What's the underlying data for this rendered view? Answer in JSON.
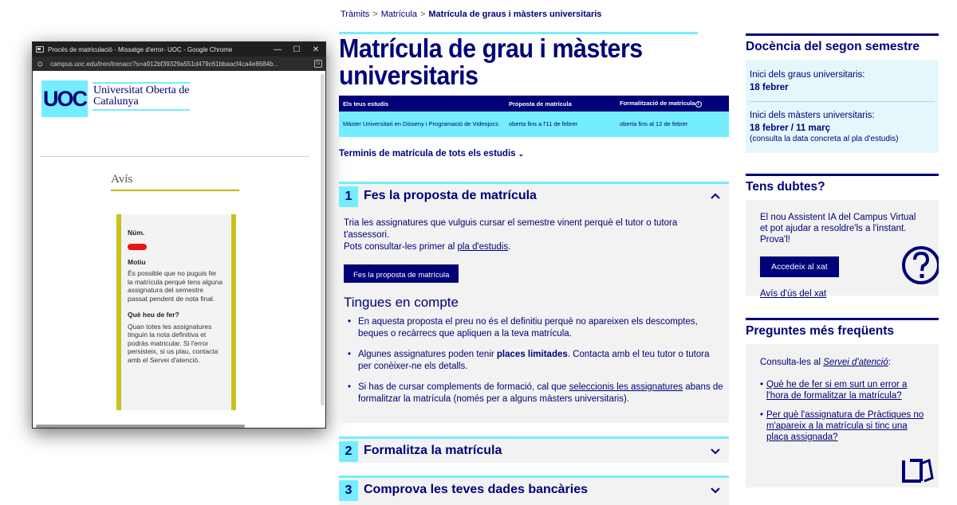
{
  "popup": {
    "window_title": "Procés de matriculació - Missatge d'error- UOC - Google Chrome",
    "url": "campus.uoc.edu/tren/trenacc?s=a912bf39329a551d479c61bbaacf4ca4e8684b...",
    "minimize": "—",
    "maximize": "☐",
    "close": "✕",
    "logo_text": "UOC",
    "university_name": "Universitat Oberta de Catalunya",
    "avis_title": "Avís",
    "num_label": "Núm.",
    "motiu_label": "Motiu",
    "motiu_text": "És possible que no puguis fer la matrícula perquè tens alguna assignatura del semestre passat pendent de nota final.",
    "que_fer_label": "Què heu de fer?",
    "que_fer_text": "Quan totes les assignatures tinguin la nota definitiva et podràs matricular. Si l'error persisteix, si us plau, contacta amb el Servei d'atenció."
  },
  "breadcrumb": {
    "items": [
      "Tràmits",
      "Matrícula"
    ],
    "separator": ">",
    "current": "Matrícula de graus i màsters universitaris"
  },
  "main": {
    "title": "Matrícula de grau i màsters universitaris",
    "table": {
      "headers": [
        "Els teus estudis",
        "Proposta de matrícula",
        "Formalització de matrícula"
      ],
      "rows": [
        [
          "Màster Universitari en Disseny i Programació de Videojocs",
          "oberta fins a l'11 de febrer",
          "oberta fins al 12 de febrer"
        ]
      ]
    },
    "terminis_link": "Terminis de matrícula de tots els estudis",
    "steps": [
      {
        "number": "1",
        "title": "Fes la proposta de matrícula",
        "intro_1": "Tria les assignatures que vulguis cursar el semestre vinent perquè el tutor o tutora t'assessori.",
        "intro_2": "Pots consultar-les primer al ",
        "intro_link": "pla d'estudis",
        "intro_end": ".",
        "button": "Fes la proposta de matrícula",
        "subtitle": "Tingues en compte",
        "bullet_1": "En aquesta proposta el preu no és el definitiu perquè no apareixen els descomptes, beques o recàrrecs que apliquen a la teva matrícula.",
        "bullet_2_a": "Algunes assignatures poden tenir ",
        "bullet_2_b": "places limitades",
        "bullet_2_c": ". Contacta amb el teu tutor o tutora per conèixer-ne els detalls.",
        "bullet_3_a": "Si has de cursar complements de formació, cal que ",
        "bullet_3_link": "seleccionis les assignatures",
        "bullet_3_b": " abans de formalitzar la matrícula (només per a alguns màsters universitaris)."
      },
      {
        "number": "2",
        "title": "Formalitza la matrícula"
      },
      {
        "number": "3",
        "title": "Comprova les teves dades bancàries"
      }
    ]
  },
  "sidebar": {
    "docencia": {
      "heading": "Docència del segon semestre",
      "graus_label": "Inici dels graus universitaris:",
      "graus_date": "18 febrer",
      "masters_label": "Inici dels màsters universitaris:",
      "masters_date": "18 febrer / 11 març",
      "masters_note": "(consulta la data concreta al pla d'estudis)"
    },
    "dubtes": {
      "heading": "Tens dubtes?",
      "text": "El nou Assistent IA del Campus Virtual et pot ajudar a resoldre'ls a l'instant. Prova'l!",
      "button": "Accedeix al xat",
      "link": "Avís d'ús del xat"
    },
    "faq": {
      "heading": "Preguntes més freqüents",
      "intro": "Consulta-les al ",
      "intro_link": "Servei d'atenció",
      "intro_end": ":",
      "items": [
        "Què he de fer si em surt un error a l'hora de formalitzar la matrícula?",
        "Per què l'assignatura de Pràctiques no m'apareix a la matrícula si tinc una plaça assignada?"
      ]
    }
  },
  "colors": {
    "navy": "#000078",
    "cyan": "#73edff",
    "yellow": "#c9c21c",
    "redaction": "#e8141a"
  }
}
